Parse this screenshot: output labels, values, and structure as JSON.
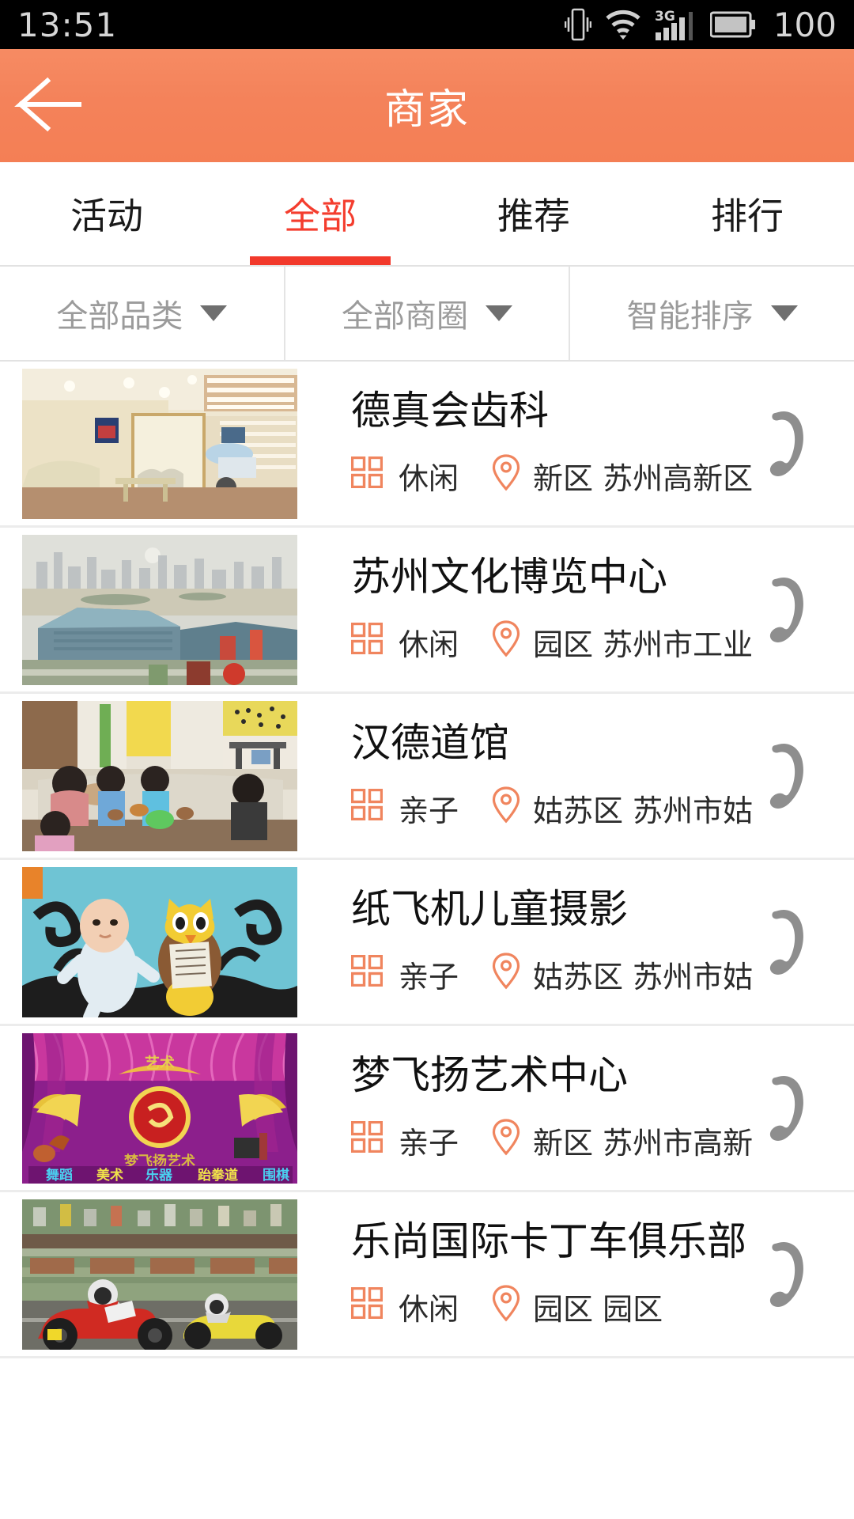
{
  "status_bar": {
    "time": "13:51",
    "battery_level": "100",
    "icons": [
      "vibrate-icon",
      "wifi-icon",
      "signal-3g-icon",
      "battery-icon"
    ],
    "network": "3G"
  },
  "header": {
    "title": "商家",
    "back_icon": "back-arrow-icon",
    "accent_color": "#f4825a"
  },
  "tabs": [
    {
      "label": "活动",
      "active": false
    },
    {
      "label": "全部",
      "active": true
    },
    {
      "label": "推荐",
      "active": false
    },
    {
      "label": "排行",
      "active": false
    }
  ],
  "active_tab_color": "#f2392b",
  "filters": [
    {
      "label": "全部品类",
      "icon": "chevron-down-icon"
    },
    {
      "label": "全部商圈",
      "icon": "chevron-down-icon"
    },
    {
      "label": "智能排序",
      "icon": "chevron-down-icon"
    }
  ],
  "merchants": [
    {
      "name": "德真会齿科",
      "category": "休闲",
      "address": "新区 苏州高新区 ..",
      "thumb": "dental-clinic-interior",
      "call_icon": "phone-icon"
    },
    {
      "name": "苏州文化博览中心",
      "category": "休闲",
      "address": "园区 苏州市工业 ..",
      "thumb": "suzhou-culture-center",
      "call_icon": "phone-icon"
    },
    {
      "name": "汉德道馆",
      "category": "亲子",
      "address": "姑苏区 苏州市姑 ..",
      "thumb": "kids-sand-play-classroom",
      "call_icon": "phone-icon"
    },
    {
      "name": "纸飞机儿童摄影",
      "category": "亲子",
      "address": "姑苏区 苏州市姑 ..",
      "thumb": "baby-owl-photo",
      "call_icon": "phone-icon"
    },
    {
      "name": "梦飞扬艺术中心",
      "category": "亲子",
      "address": "新区 苏州市高新 ..",
      "thumb": "art-center-pink-banner",
      "call_icon": "phone-icon"
    },
    {
      "name": "乐尚国际卡丁车俱乐部",
      "category": "休闲",
      "address": "园区 园区",
      "thumb": "go-kart-racing",
      "call_icon": "phone-icon"
    }
  ]
}
